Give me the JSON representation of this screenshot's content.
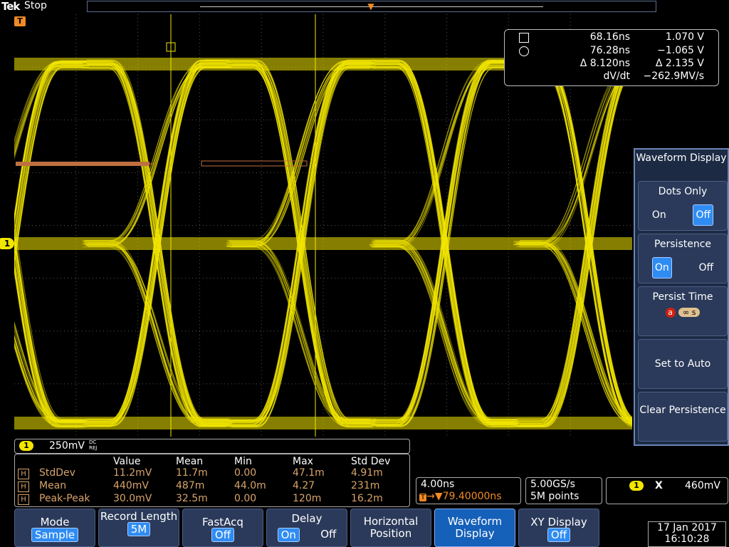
{
  "header": {
    "brand": "Tek",
    "status": "Stop"
  },
  "markers": {
    "trigger": "T",
    "channel": "1"
  },
  "cursor_readout": {
    "rows": [
      {
        "icon": "square",
        "left": "68.16ns",
        "right": "1.070 V"
      },
      {
        "icon": "circle",
        "left": "76.28ns",
        "right": "−1.065 V"
      },
      {
        "left": "Δ 8.120ns",
        "right": "Δ 2.135 V"
      },
      {
        "left": "dV/dt",
        "right": "−262.9MV/s"
      }
    ]
  },
  "side_menu": {
    "title": "Waveform Display",
    "dots_only": {
      "label": "Dots Only",
      "on": "On",
      "off": "Off"
    },
    "persistence": {
      "label": "Persistence",
      "on": "On",
      "off": "Off"
    },
    "persist_time": {
      "label": "Persist Time",
      "knob": "a",
      "value": "∞ s"
    },
    "set_auto": "Set to Auto",
    "clear": "Clear Persistence"
  },
  "channel_scale": {
    "ch": "1",
    "scale": "250mV",
    "coupling": "DC REJ"
  },
  "measurements": {
    "headers": [
      "Value",
      "Mean",
      "Min",
      "Max",
      "Std Dev"
    ],
    "rows": [
      {
        "h": "H",
        "name": "StdDev",
        "value": "11.2mV",
        "mean": "11.7m",
        "min": "0.00",
        "max": "47.1m",
        "std": "4.91m"
      },
      {
        "h": "H",
        "name": "Mean",
        "value": "440mV",
        "mean": "487m",
        "min": "44.0m",
        "max": "4.27",
        "std": "231m"
      },
      {
        "h": "H",
        "name": "Peak-Peak",
        "value": "30.0mV",
        "mean": "32.5m",
        "min": "0.00",
        "max": "120m",
        "std": "16.2m"
      }
    ]
  },
  "horizontal": {
    "scale": "4.00ns",
    "delay": "79.40000ns",
    "rate": "5.00GS/s",
    "points": "5M points"
  },
  "trigger_readout": {
    "ch": "1",
    "x": "X",
    "level": "460mV"
  },
  "bottom_menu": [
    {
      "label": "Mode",
      "value": "Sample"
    },
    {
      "label": "Record Length",
      "value": "5M"
    },
    {
      "label": "FastAcq",
      "value": "Off"
    },
    {
      "label": "Delay",
      "on": "On",
      "off": "Off"
    },
    {
      "label": "Horizontal Position"
    },
    {
      "label": "Waveform Display",
      "active": true
    },
    {
      "label": "XY Display",
      "value": "Off"
    }
  ],
  "datetime": {
    "date": "17 Jan  2017",
    "time": "16:10:28"
  },
  "colors": {
    "trace": "#f2e600",
    "accent": "#2f8cf3",
    "menu": "#2b3a5a",
    "meas": "#d7a36a",
    "ref": "#c07040"
  }
}
